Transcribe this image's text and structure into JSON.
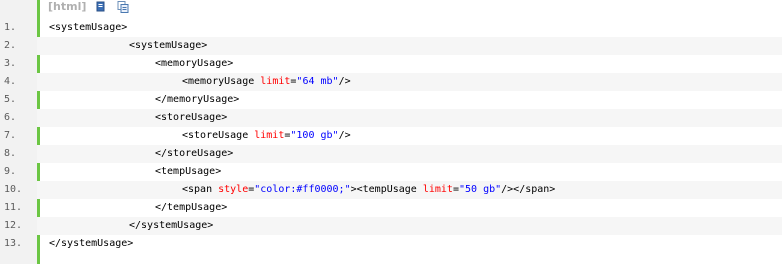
{
  "toolbar": {
    "label": "[html]",
    "icons": [
      "view-source-icon",
      "copy-icon"
    ]
  },
  "code": {
    "lines": [
      {
        "num": "1.",
        "indent": 0,
        "parts": [
          {
            "t": "tag",
            "v": "<systemUsage>"
          }
        ]
      },
      {
        "num": "2.",
        "indent": 1,
        "parts": [
          {
            "t": "tag",
            "v": "<systemUsage>"
          }
        ]
      },
      {
        "num": "3.",
        "indent": 2,
        "parts": [
          {
            "t": "tag",
            "v": "<memoryUsage>"
          }
        ]
      },
      {
        "num": "4.",
        "indent": 3,
        "parts": [
          {
            "t": "tag",
            "v": "<memoryUsage "
          },
          {
            "t": "attr",
            "v": "limit"
          },
          {
            "t": "eq",
            "v": "="
          },
          {
            "t": "val",
            "v": "\"64 mb\""
          },
          {
            "t": "tag",
            "v": "/>"
          }
        ]
      },
      {
        "num": "5.",
        "indent": 2,
        "parts": [
          {
            "t": "tag",
            "v": "</memoryUsage>"
          }
        ]
      },
      {
        "num": "6.",
        "indent": 2,
        "parts": [
          {
            "t": "tag",
            "v": "<storeUsage>"
          }
        ]
      },
      {
        "num": "7.",
        "indent": 3,
        "parts": [
          {
            "t": "tag",
            "v": "<storeUsage "
          },
          {
            "t": "attr",
            "v": "limit"
          },
          {
            "t": "eq",
            "v": "="
          },
          {
            "t": "val",
            "v": "\"100 gb\""
          },
          {
            "t": "tag",
            "v": "/>"
          }
        ]
      },
      {
        "num": "8.",
        "indent": 2,
        "parts": [
          {
            "t": "tag",
            "v": "</storeUsage>"
          }
        ]
      },
      {
        "num": "9.",
        "indent": 2,
        "parts": [
          {
            "t": "tag",
            "v": "<tempUsage>"
          }
        ]
      },
      {
        "num": "10.",
        "indent": 3,
        "parts": [
          {
            "t": "tag",
            "v": "<span "
          },
          {
            "t": "attr",
            "v": "style"
          },
          {
            "t": "eq",
            "v": "="
          },
          {
            "t": "val",
            "v": "\"color:#ff0000;\""
          },
          {
            "t": "tag",
            "v": "><tempUsage "
          },
          {
            "t": "attr",
            "v": "limit"
          },
          {
            "t": "eq",
            "v": "="
          },
          {
            "t": "val",
            "v": "\"50 gb\""
          },
          {
            "t": "tag",
            "v": "/></span>"
          }
        ]
      },
      {
        "num": "11.",
        "indent": 2,
        "parts": [
          {
            "t": "tag",
            "v": "</tempUsage>"
          }
        ]
      },
      {
        "num": "12.",
        "indent": 1,
        "parts": [
          {
            "t": "tag",
            "v": "</systemUsage>"
          }
        ]
      },
      {
        "num": "13.",
        "indent": 0,
        "parts": [
          {
            "t": "tag",
            "v": "</systemUsage>"
          }
        ]
      }
    ]
  }
}
